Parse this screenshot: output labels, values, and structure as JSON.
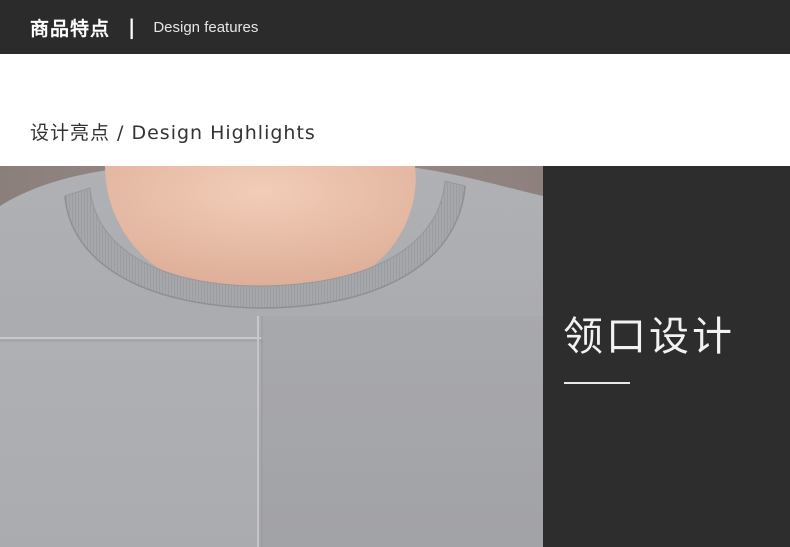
{
  "header": {
    "title_cn": "商品特点",
    "separator": "|",
    "title_en": "Design features"
  },
  "section": {
    "subtitle": "设计亮点 / Design Highlights"
  },
  "feature": {
    "title": "领口设计"
  },
  "colors": {
    "header_bg": "#2b2b2b",
    "panel_bg": "#2d2d2d",
    "sweater": "#a9aaad"
  }
}
